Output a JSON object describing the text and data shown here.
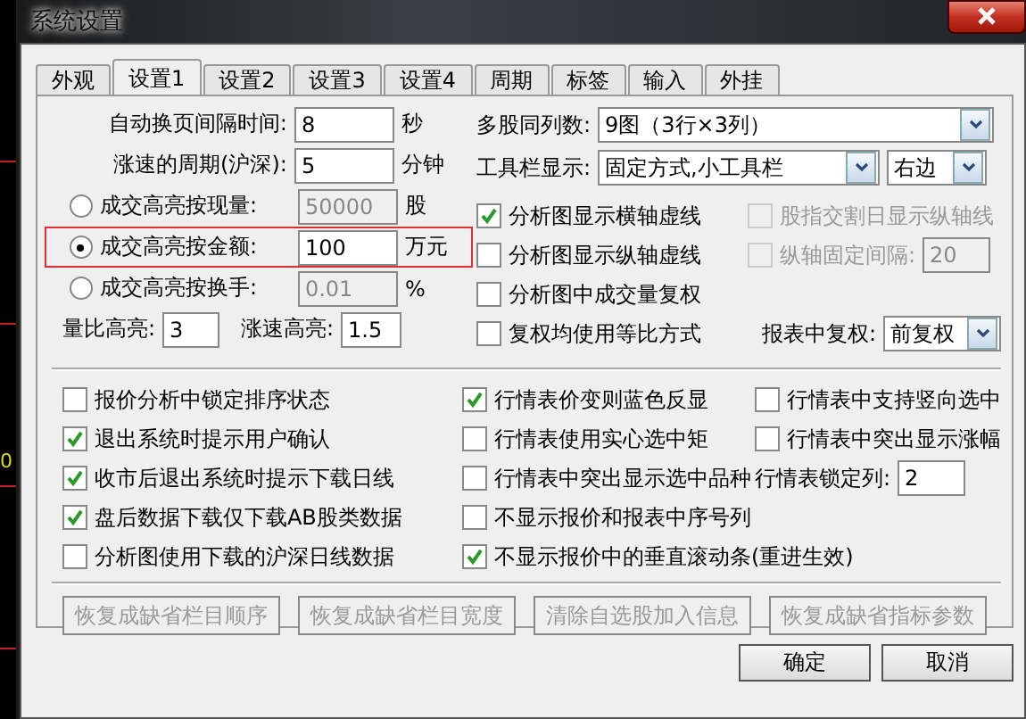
{
  "background_chart": {
    "label": "0"
  },
  "window": {
    "title": "系统设置"
  },
  "tabs": [
    {
      "label": "外观",
      "selected": false
    },
    {
      "label": "设置1",
      "selected": true
    },
    {
      "label": "设置2",
      "selected": false
    },
    {
      "label": "设置3",
      "selected": false
    },
    {
      "label": "设置4",
      "selected": false
    },
    {
      "label": "周期",
      "selected": false
    },
    {
      "label": "标签",
      "selected": false
    },
    {
      "label": "输入",
      "selected": false
    },
    {
      "label": "外挂",
      "selected": false
    }
  ],
  "left_rows": [
    {
      "kind": "field",
      "label": "自动换页间隔时间:",
      "value": "8",
      "unit": "秒",
      "disabled": false
    },
    {
      "kind": "field",
      "label": "涨速的周期(沪深):",
      "value": "5",
      "unit": "分钟",
      "disabled": false
    },
    {
      "kind": "radio",
      "label": "成交高亮按现量:",
      "value": "50000",
      "unit": "股",
      "selected": false,
      "disabled": true,
      "highlighted": false
    },
    {
      "kind": "radio",
      "label": "成交高亮按金额:",
      "value": "100",
      "unit": "万元",
      "selected": true,
      "disabled": false,
      "highlighted": true
    },
    {
      "kind": "radio",
      "label": "成交高亮按换手:",
      "value": "0.01",
      "unit": "%",
      "selected": false,
      "disabled": true,
      "highlighted": false
    }
  ],
  "highlight_fields": [
    {
      "label": "量比高亮:",
      "value": "3"
    },
    {
      "label": "涨速高亮:",
      "value": "1.5"
    }
  ],
  "dropdowns": [
    {
      "label": "多股同列数:",
      "values": [
        "9图（3行×3列）"
      ]
    },
    {
      "label": "工具栏显示:",
      "values": [
        "固定方式,小工具栏",
        "右边"
      ]
    }
  ],
  "right_options": [
    {
      "kind": "check",
      "label": "分析图显示横轴虚线",
      "checked": true,
      "disabled": false
    },
    {
      "kind": "check",
      "label": "股指交割日显示纵轴线",
      "checked": false,
      "disabled": true
    },
    {
      "kind": "check",
      "label": "分析图显示纵轴虚线",
      "checked": false,
      "disabled": false
    },
    {
      "kind": "check_field",
      "label": "纵轴固定间隔:",
      "value": "20",
      "checked": false,
      "disabled": true
    },
    {
      "kind": "check",
      "label": "分析图中成交量复权",
      "checked": false,
      "disabled": false
    },
    {
      "kind": "empty"
    },
    {
      "kind": "check",
      "label": "复权均使用等比方式",
      "checked": false,
      "disabled": false
    },
    {
      "kind": "select",
      "label": "报表中复权:",
      "value": "前复权"
    }
  ],
  "lower_columns": [
    [
      {
        "kind": "check",
        "label": "报价分析中锁定排序状态",
        "checked": false
      },
      {
        "kind": "check",
        "label": "退出系统时提示用户确认",
        "checked": true
      },
      {
        "kind": "check",
        "label": "收市后退出系统时提示下载日线",
        "checked": true
      },
      {
        "kind": "check",
        "label": "盘后数据下载仅下载AB股类数据",
        "checked": true
      },
      {
        "kind": "check",
        "label": "分析图使用下载的沪深日线数据",
        "checked": false
      }
    ],
    [
      {
        "kind": "check",
        "label": "行情表价变则蓝色反显",
        "checked": true
      },
      {
        "kind": "check",
        "label": "行情表使用实心选中矩",
        "checked": false
      },
      {
        "kind": "check",
        "label": "行情表中突出显示选中品种",
        "checked": false
      },
      {
        "kind": "check",
        "label": "不显示报价和报表中序号列",
        "checked": false
      },
      {
        "kind": "check",
        "label": "不显示报价中的垂直滚动条(重进生效)",
        "checked": true
      }
    ],
    [
      {
        "kind": "check",
        "label": "行情表中支持竖向选中",
        "checked": false
      },
      {
        "kind": "check",
        "label": "行情表中突出显示涨幅",
        "checked": false
      },
      {
        "kind": "field",
        "label": "行情表锁定列:",
        "value": "2"
      }
    ]
  ],
  "reset_buttons": [
    {
      "label": "恢复成缺省栏目顺序",
      "disabled": true
    },
    {
      "label": "恢复成缺省栏目宽度",
      "disabled": true
    },
    {
      "label": "清除自选股加入信息",
      "disabled": true
    },
    {
      "label": "恢复成缺省指标参数",
      "disabled": true
    }
  ],
  "footer_buttons": [
    "确定",
    "取消"
  ]
}
